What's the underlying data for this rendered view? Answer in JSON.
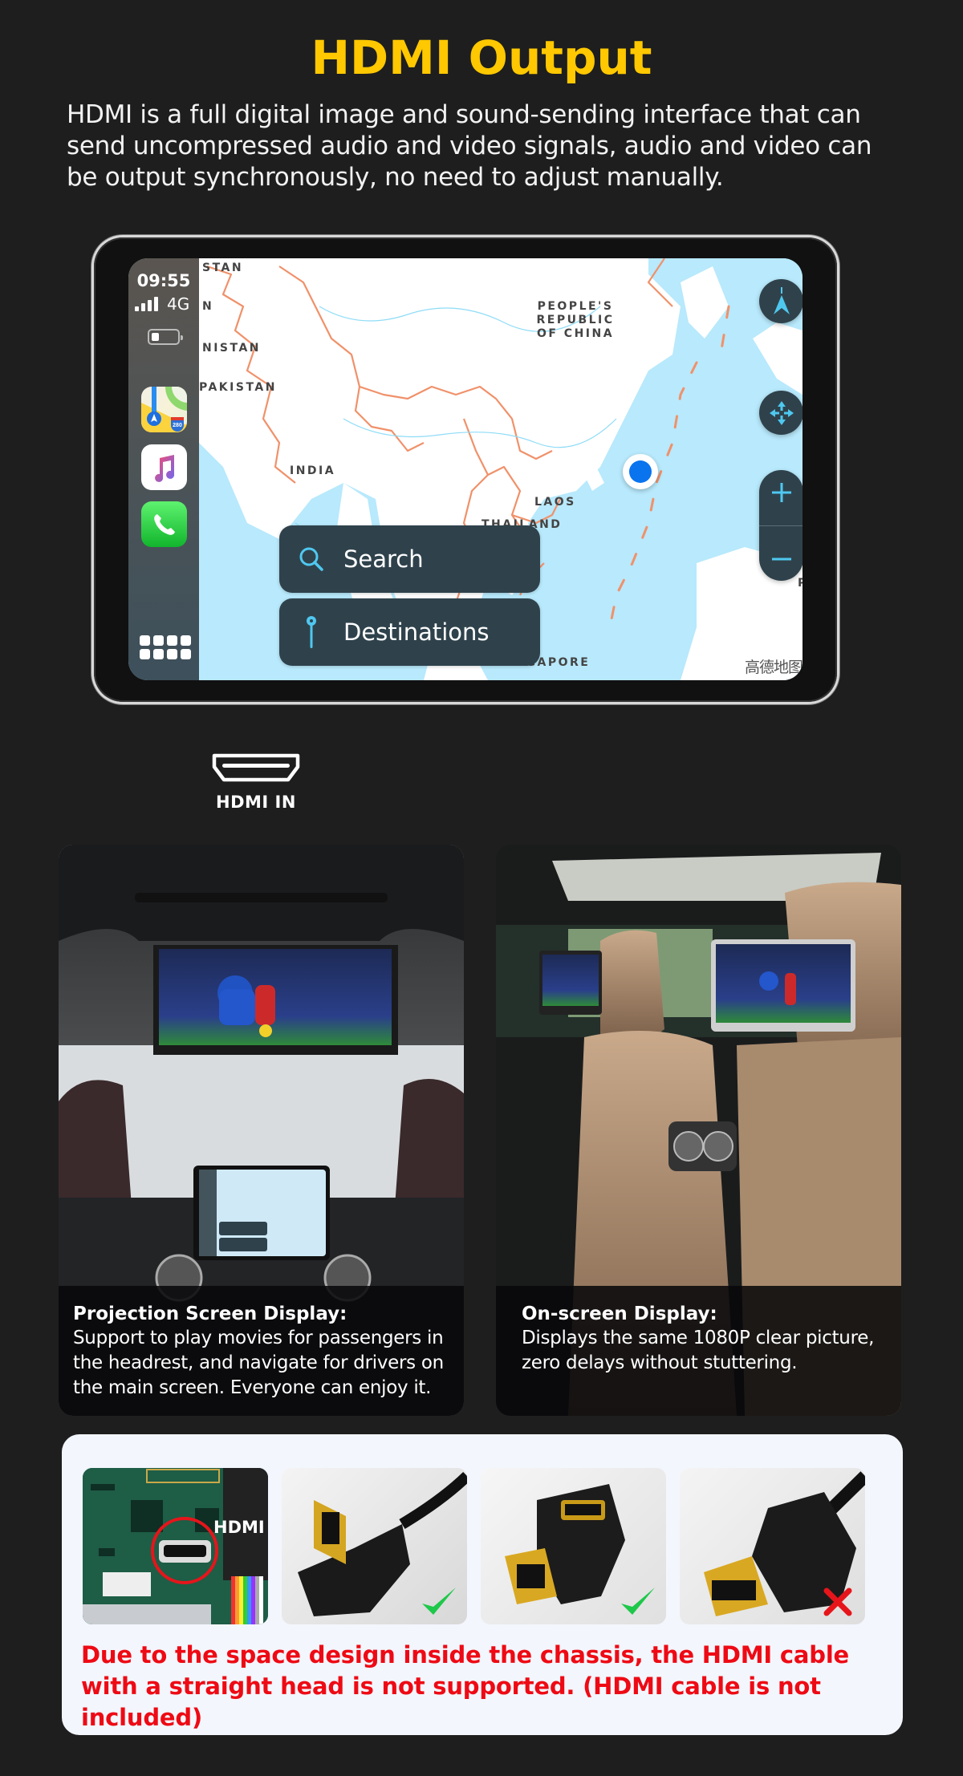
{
  "header": {
    "title": "HDMI Output",
    "description": "HDMI is a full digital image and sound-sending interface that can send uncompressed audio and video signals, audio and video can be output synchronously, no need to adjust manually."
  },
  "device": {
    "status": {
      "time": "09:55",
      "network": "4G",
      "signal_bars": 4
    },
    "dock_apps": [
      {
        "name": "Maps",
        "icon": "maps-app-icon"
      },
      {
        "name": "Music",
        "icon": "music-app-icon"
      },
      {
        "name": "Phone",
        "icon": "phone-app-icon"
      }
    ],
    "map": {
      "labels": {
        "stan": "STAN",
        "n": "N",
        "afghanistan": "NISTAN",
        "pakistan": "PAKISTAN",
        "india": "INDIA",
        "china": "PEOPLE'S REPUBLIC OF CHINA",
        "laos": "LAOS",
        "thailand": "THAILAND",
        "singapore": "SINGAPORE",
        "edge_p": "P"
      },
      "watermark": "高德地图",
      "buttons": {
        "search": "Search",
        "destinations": "Destinations"
      },
      "controls": [
        "compass",
        "pan",
        "zoom-in",
        "zoom-out"
      ]
    },
    "accent_color": "#4fc8f0"
  },
  "hdmi_port": {
    "label": "HDMI IN"
  },
  "features": [
    {
      "title": "Projection Screen Display:",
      "text": "Support to play movies for passengers in the headrest, and navigate for drivers on the main screen. Everyone can enjoy it."
    },
    {
      "title": "On-screen Display:",
      "text": "Displays the same 1080P clear picture, zero delays without stuttering."
    }
  ],
  "cables": {
    "items": [
      {
        "name": "pcb-hdmi-port",
        "label": "HDMI",
        "status": "none"
      },
      {
        "name": "right-angle-hdmi-cable",
        "status": "supported"
      },
      {
        "name": "right-angle-hdmi-adapter",
        "status": "supported"
      },
      {
        "name": "straight-hdmi-cable",
        "status": "not-supported"
      }
    ],
    "note": "Due to the space design inside the chassis, the HDMI cable with a straight head is not supported. (HDMI cable is not included)"
  },
  "colors": {
    "title": "#FFC800",
    "background": "#1e1e1e",
    "warning": "#ee0a14",
    "check": "#1ec84a"
  }
}
